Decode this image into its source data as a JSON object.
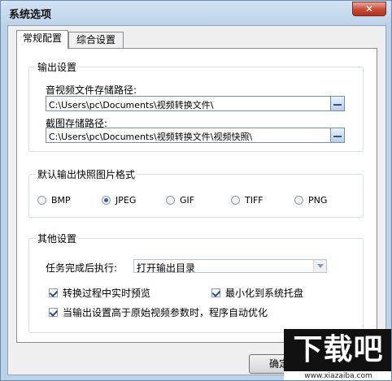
{
  "window": {
    "title": "系统选项",
    "close_label": "✕"
  },
  "tabs": [
    {
      "label": "常规配置",
      "active": true
    },
    {
      "label": "综合设置",
      "active": false
    }
  ],
  "output_settings": {
    "title": "输出设置",
    "video_path_label": "音视频文件存储路径:",
    "video_path_value": "C:\\Users\\pc\\Documents\\视频转换文件\\",
    "snapshot_path_label": "截图存储路径:",
    "snapshot_path_value": "C:\\Users\\pc\\Documents\\视频转换文件\\视频快照\\"
  },
  "snapshot_format": {
    "title": "默认输出快照图片格式",
    "options": [
      {
        "label": "BMP",
        "checked": false
      },
      {
        "label": "JPEG",
        "checked": true
      },
      {
        "label": "GIF",
        "checked": false
      },
      {
        "label": "TIFF",
        "checked": false
      },
      {
        "label": "PNG",
        "checked": false
      }
    ]
  },
  "other_settings": {
    "title": "其他设置",
    "after_task_label": "任务完成后执行:",
    "after_task_value": "打开输出目录",
    "realtime_preview": {
      "label": "转换过程中实时预览",
      "checked": true
    },
    "minimize_to_tray": {
      "label": "最小化到系统托盘",
      "checked": true
    },
    "auto_optimize": {
      "label": "当输出设置高于原始视频参数时，程序自动优化",
      "checked": true
    }
  },
  "buttons": {
    "ok": "确定"
  },
  "watermark": {
    "logo": "下载吧",
    "url": "www.xiazaiba.com"
  }
}
